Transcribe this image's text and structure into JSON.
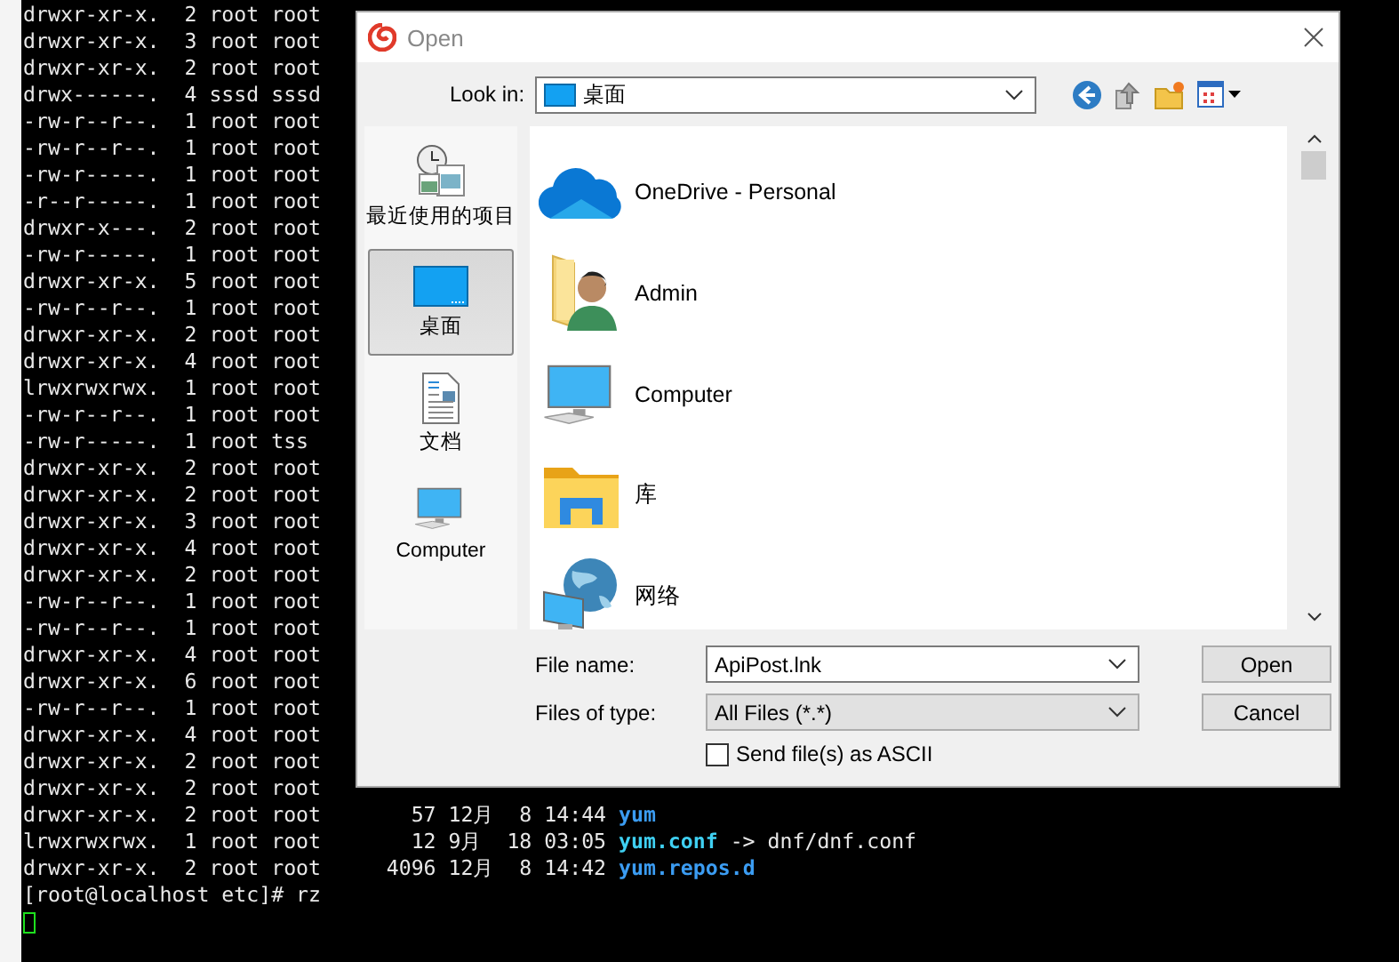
{
  "terminal": {
    "rows": [
      {
        "text": "drwxr-xr-x.  2 root root"
      },
      {
        "text": "drwxr-xr-x.  3 root root"
      },
      {
        "text": "drwxr-xr-x.  2 root root"
      },
      {
        "text": "drwx------.  4 sssd sssd"
      },
      {
        "text": "-rw-r--r--.  1 root root"
      },
      {
        "text": "-rw-r--r--.  1 root root"
      },
      {
        "text": "-rw-r-----.  1 root root"
      },
      {
        "text": "-r--r-----.  1 root root"
      },
      {
        "text": "drwxr-x---.  2 root root"
      },
      {
        "text": "-rw-r-----.  1 root root"
      },
      {
        "text": "drwxr-xr-x.  5 root root"
      },
      {
        "text": "-rw-r--r--.  1 root root"
      },
      {
        "text": "drwxr-xr-x.  2 root root"
      },
      {
        "text": "drwxr-xr-x.  4 root root"
      },
      {
        "text": "lrwxrwxrwx.  1 root root"
      },
      {
        "text": "-rw-r--r--.  1 root root"
      },
      {
        "text": "-rw-r-----.  1 root tss"
      },
      {
        "text": "drwxr-xr-x.  2 root root"
      },
      {
        "text": "drwxr-xr-x.  2 root root"
      },
      {
        "text": "drwxr-xr-x.  3 root root"
      },
      {
        "text": "drwxr-xr-x.  4 root root"
      },
      {
        "text": "drwxr-xr-x.  2 root root"
      },
      {
        "text": "-rw-r--r--.  1 root root"
      },
      {
        "text": "-rw-r--r--.  1 root root"
      },
      {
        "text": "drwxr-xr-x.  4 root root"
      },
      {
        "text": "drwxr-xr-x.  6 root root"
      },
      {
        "text": "-rw-r--r--.  1 root root"
      },
      {
        "text": "drwxr-xr-x.  4 root root"
      },
      {
        "text": "drwxr-xr-x.  2 root root"
      },
      {
        "text": "drwxr-xr-x.  2 root root"
      },
      {
        "text": "drwxr-xr-x.  2 root root",
        "info": "57 12月  8 14:44",
        "name": "yum",
        "color": "#3b9cf2"
      },
      {
        "text": "lrwxrwxrwx.  1 root root",
        "info": "12 9月  18 03:05",
        "name": "yum.conf",
        "color": "#3fd0f2",
        "target": "-> dnf/dnf.conf"
      },
      {
        "text": "drwxr-xr-x.  2 root root",
        "info": "4096 12月  8 14:42",
        "name": "yum.repos.d",
        "color": "#3b9cf2"
      }
    ],
    "prompt": "[root@localhost etc]# rz"
  },
  "dialog": {
    "title": "Open",
    "look_in": {
      "label": "Look in:",
      "value": "桌面"
    },
    "places": [
      {
        "label": "最近使用的项目",
        "kind": "recent",
        "selected": false
      },
      {
        "label": "桌面",
        "kind": "desktop",
        "selected": true
      },
      {
        "label": "文档",
        "kind": "documents",
        "selected": false
      },
      {
        "label": "Computer",
        "kind": "computer",
        "selected": false
      }
    ],
    "files": [
      {
        "name": "OneDrive - Personal",
        "kind": "cloud"
      },
      {
        "name": "Admin",
        "kind": "user-folder"
      },
      {
        "name": "Computer",
        "kind": "computer"
      },
      {
        "name": "库",
        "kind": "library"
      },
      {
        "name": "网络",
        "kind": "network"
      }
    ],
    "file_name": {
      "label": "File name:",
      "value": "ApiPost.lnk"
    },
    "file_type": {
      "label": "Files of type:",
      "value": "All Files (*.*)"
    },
    "ascii": {
      "label": "Send file(s) as ASCII",
      "checked": false
    },
    "buttons": [
      "Open",
      "Cancel"
    ]
  }
}
